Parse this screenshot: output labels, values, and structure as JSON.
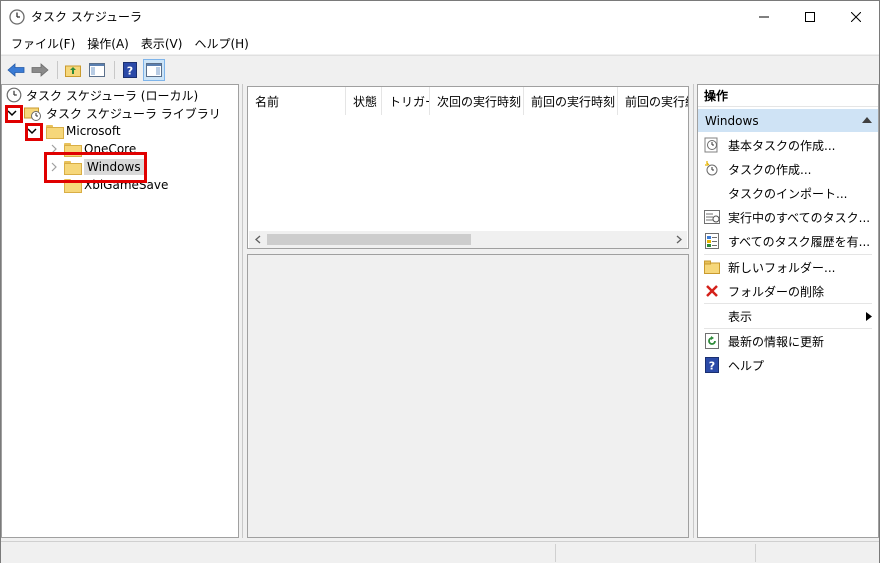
{
  "window": {
    "title": "タスク スケジューラ"
  },
  "menu": {
    "items": [
      {
        "label": "ファイル(F)"
      },
      {
        "label": "操作(A)"
      },
      {
        "label": "表示(V)"
      },
      {
        "label": "ヘルプ(H)"
      }
    ]
  },
  "tree": {
    "root": "タスク スケジューラ (ローカル)",
    "library": "タスク スケジューラ ライブラリ",
    "microsoft": "Microsoft",
    "onecore": "OneCore",
    "windows": "Windows",
    "xblgamesave": "XblGameSave"
  },
  "table": {
    "columns": [
      "名前",
      "状態",
      "トリガー",
      "次回の実行時刻",
      "前回の実行時刻",
      "前回の実行結果"
    ]
  },
  "actions": {
    "header": "操作",
    "group": "Windows",
    "items": [
      {
        "label": "基本タスクの作成...",
        "icon": "basic-task-icon"
      },
      {
        "label": "タスクの作成...",
        "icon": "create-task-icon"
      },
      {
        "label": "タスクのインポート...",
        "icon": ""
      },
      {
        "label": "実行中のすべてのタスク...",
        "icon": "running-tasks-icon"
      },
      {
        "label": "すべてのタスク履歴を有...",
        "icon": "history-icon"
      },
      {
        "label": "新しいフォルダー...",
        "icon": "new-folder-icon"
      },
      {
        "label": "フォルダーの削除",
        "icon": "delete-icon"
      },
      {
        "label": "表示",
        "icon": ""
      },
      {
        "label": "最新の情報に更新",
        "icon": "refresh-icon"
      },
      {
        "label": "ヘルプ",
        "icon": "help-icon"
      }
    ]
  },
  "colors": {
    "highlight_red": "#e00000",
    "group_blue": "#cfe3f5",
    "delete_red": "#d4201a",
    "help_blue": "#2b4aa8"
  }
}
